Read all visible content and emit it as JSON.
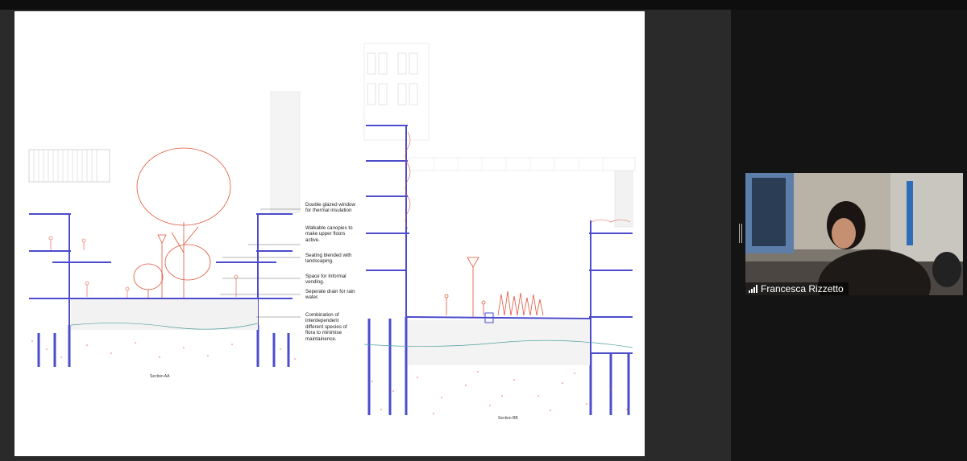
{
  "presentation": {
    "section_aa_label": "Section AA",
    "section_bb_label": "Section BB",
    "annotations": [
      "Double glazed window for thermal insulation",
      "Walkable canopies to make upper floors active.",
      "Seating blended with landscaping.",
      "Space for Informal vending.",
      "Seperate drain for rain water.",
      "Combination of interdependent different species of flora to minimise maintainence."
    ]
  },
  "participant": {
    "name": "Francesca Rizzetto",
    "icon": "signal-bars-icon"
  },
  "colors": {
    "structure": "#4c4ccc",
    "vegetation": "#e0553a",
    "background": "#1b1b1b"
  }
}
